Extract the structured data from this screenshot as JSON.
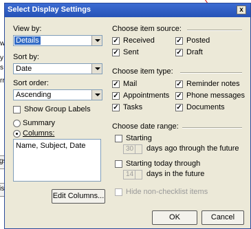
{
  "background_window": {
    "fragments": [
      "w",
      "y",
      "s",
      "rro",
      "gs",
      "ist"
    ]
  },
  "dialog": {
    "title": "Select Display Settings",
    "close_label": "x",
    "view_by": {
      "label": "View by:",
      "value": "Details"
    },
    "sort_by": {
      "label": "Sort by:",
      "value": "Date"
    },
    "sort_order": {
      "label": "Sort order:",
      "value": "Ascending"
    },
    "show_group_labels": {
      "label": "Show Group Labels",
      "checked": false
    },
    "summary_radio": {
      "label": "Summary",
      "selected": false
    },
    "columns_radio": {
      "label": "Columns:",
      "selected": true
    },
    "columns_list": "Name, Subject, Date",
    "edit_columns_button": "Edit Columns...",
    "item_source": {
      "heading": "Choose item source:",
      "items": [
        {
          "label": "Received",
          "checked": true
        },
        {
          "label": "Posted",
          "checked": true
        },
        {
          "label": "Sent",
          "checked": true
        },
        {
          "label": "Draft",
          "checked": true
        }
      ]
    },
    "item_type": {
      "heading": "Choose item type:",
      "items": [
        {
          "label": "Mail",
          "checked": true
        },
        {
          "label": "Reminder notes",
          "checked": true
        },
        {
          "label": "Appointments",
          "checked": true
        },
        {
          "label": "Phone messages",
          "checked": true
        },
        {
          "label": "Tasks",
          "checked": true
        },
        {
          "label": "Documents",
          "checked": true
        }
      ]
    },
    "date_range": {
      "heading": "Choose date range:",
      "starting": {
        "label": "Starting",
        "checked": false,
        "spin_value": "30",
        "suffix": "days ago through the future"
      },
      "starting_today": {
        "label": "Starting today through",
        "checked": false,
        "spin_value": "14",
        "suffix": "days in the future"
      }
    },
    "hide_nonchecklist": {
      "label": "Hide non-checklist items",
      "checked": false
    },
    "ok_button": "OK",
    "cancel_button": "Cancel"
  }
}
